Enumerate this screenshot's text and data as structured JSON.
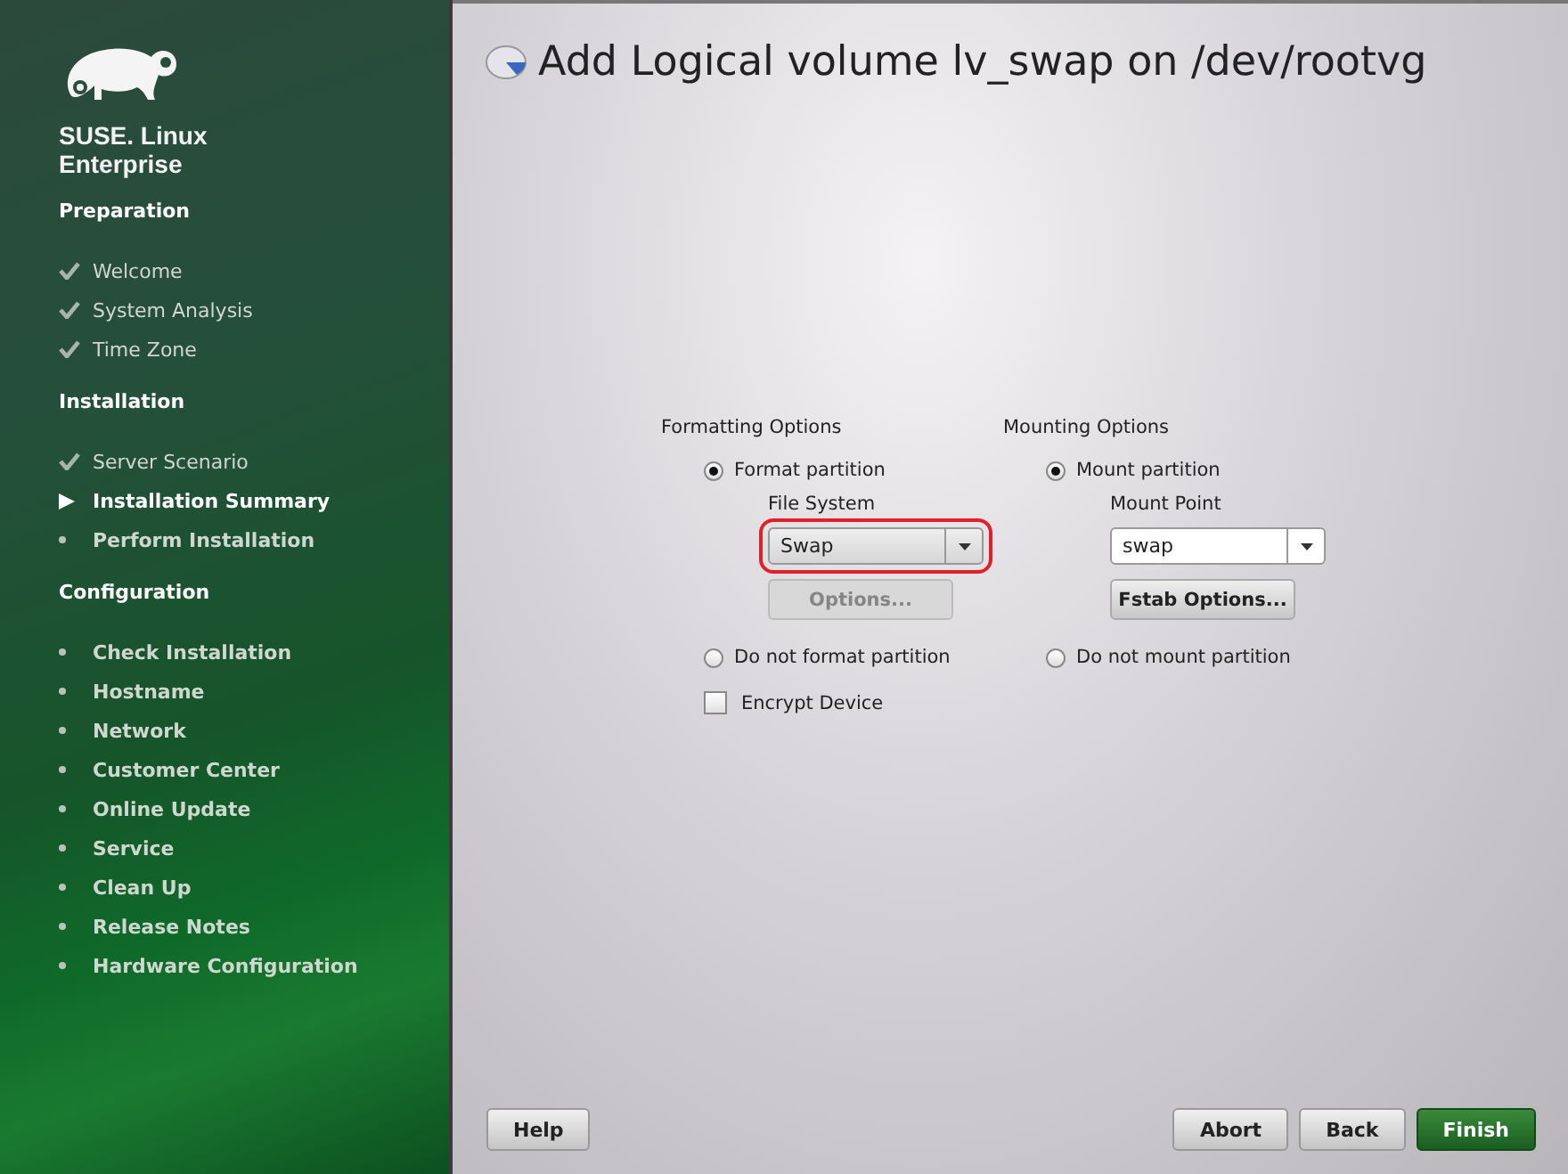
{
  "sidebar": {
    "brand": [
      "SUSE. Linux",
      "Enterprise"
    ],
    "sections": [
      {
        "title": "Preparation",
        "items": [
          {
            "label": "Welcome",
            "kind": "done"
          },
          {
            "label": "System Analysis",
            "kind": "done"
          },
          {
            "label": "Time Zone",
            "kind": "done"
          }
        ]
      },
      {
        "title": "Installation",
        "items": [
          {
            "label": "Server Scenario",
            "kind": "done"
          },
          {
            "label": "Installation Summary",
            "kind": "current"
          },
          {
            "label": "Perform Installation",
            "kind": "pending"
          }
        ]
      },
      {
        "title": "Configuration",
        "items": [
          {
            "label": "Check Installation",
            "kind": "pending"
          },
          {
            "label": "Hostname",
            "kind": "pending"
          },
          {
            "label": "Network",
            "kind": "pending"
          },
          {
            "label": "Customer Center",
            "kind": "pending"
          },
          {
            "label": "Online Update",
            "kind": "pending"
          },
          {
            "label": "Service",
            "kind": "pending"
          },
          {
            "label": "Clean Up",
            "kind": "pending"
          },
          {
            "label": "Release Notes",
            "kind": "pending"
          },
          {
            "label": "Hardware Configuration",
            "kind": "pending"
          }
        ]
      }
    ]
  },
  "dialog": {
    "title": "Add Logical volume lv_swap on /dev/rootvg",
    "formatting": {
      "heading": "Formatting Options",
      "options": [
        {
          "label": "Format partition",
          "selected": true
        },
        {
          "label": "Do not format partition",
          "selected": false
        }
      ],
      "combo_label": "File System",
      "combo_value": "Swap",
      "highlighted": true,
      "button": {
        "label": "Options...",
        "disabled": true
      },
      "checkbox": {
        "label": "Encrypt Device",
        "checked": false
      }
    },
    "mounting": {
      "heading": "Mounting Options",
      "options": [
        {
          "label": "Mount partition",
          "selected": true
        },
        {
          "label": "Do not mount partition",
          "selected": false
        }
      ],
      "combo_label": "Mount Point",
      "combo_value": "swap",
      "highlighted": false,
      "button": {
        "label": "Fstab Options...",
        "disabled": false
      }
    }
  },
  "buttons": [
    {
      "label": "Help",
      "kind": "normal"
    },
    {
      "label": "Abort",
      "kind": "normal"
    },
    {
      "label": "Back",
      "kind": "normal"
    },
    {
      "label": "Finish",
      "kind": "default"
    }
  ]
}
